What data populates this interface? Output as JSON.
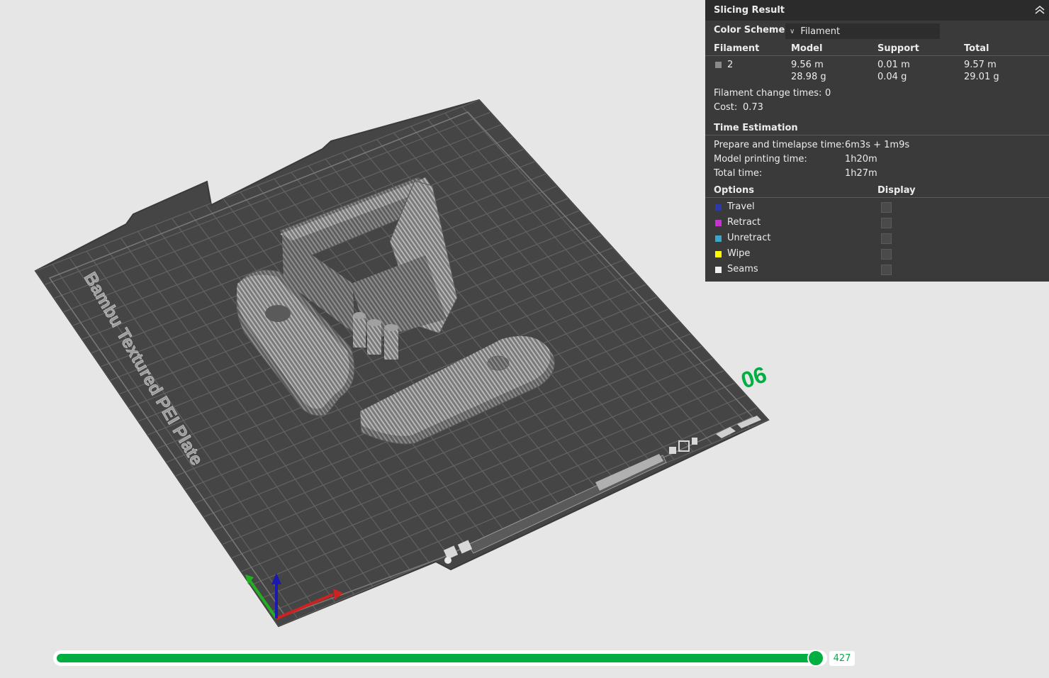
{
  "plate": {
    "label": "Bambu Textured PEI Plate",
    "number": "06"
  },
  "slicing_result": {
    "title": "Slicing Result",
    "color_scheme_label": "Color Scheme",
    "color_scheme_value": "Filament",
    "table_headers": {
      "filament": "Filament",
      "model": "Model",
      "support": "Support",
      "total": "Total"
    },
    "filament_row": {
      "id": "2",
      "swatch_color": "#8a8a8a",
      "model_length": "9.56 m",
      "model_weight": "28.98 g",
      "support_length": "0.01 m",
      "support_weight": "0.04 g",
      "total_length": "9.57 m",
      "total_weight": "29.01 g"
    },
    "filament_change_label": "Filament change times:",
    "filament_change_value": "0",
    "cost_label": "Cost:",
    "cost_value": "0.73",
    "time_estimation_label": "Time Estimation",
    "prepare_label": "Prepare and timelapse time:",
    "prepare_value": "6m3s + 1m9s",
    "model_time_label": "Model printing time:",
    "model_time_value": "1h20m",
    "total_time_label": "Total time:",
    "total_time_value": "1h27m",
    "options_label": "Options",
    "display_label": "Display",
    "options": [
      {
        "label": "Travel",
        "color": "#2b3aa8"
      },
      {
        "label": "Retract",
        "color": "#c832d2"
      },
      {
        "label": "Unretract",
        "color": "#3aa6c8"
      },
      {
        "label": "Wipe",
        "color": "#ffff00"
      },
      {
        "label": "Seams",
        "color": "#f0f0f0"
      }
    ]
  },
  "layer_slider": {
    "value": "427",
    "fraction": 1.0
  },
  "colors": {
    "accent": "#00ae42",
    "panel_bg": "#3a3a3a",
    "plate": "#454545"
  }
}
